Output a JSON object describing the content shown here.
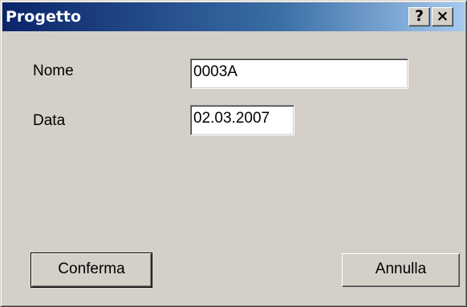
{
  "window": {
    "title": "Progetto",
    "help_glyph": "?",
    "close_glyph": "×"
  },
  "form": {
    "nome_label": "Nome",
    "nome_value": "0003A",
    "data_label": "Data",
    "data_value": "02.03.2007"
  },
  "buttons": {
    "confirm_label": "Conferma",
    "cancel_label": "Annulla"
  },
  "colors": {
    "titlebar_start": "#0a246a",
    "titlebar_end": "#a6caf0",
    "face": "#d4d0c8"
  },
  "icons": {
    "help": "help-icon",
    "close": "close-icon"
  }
}
